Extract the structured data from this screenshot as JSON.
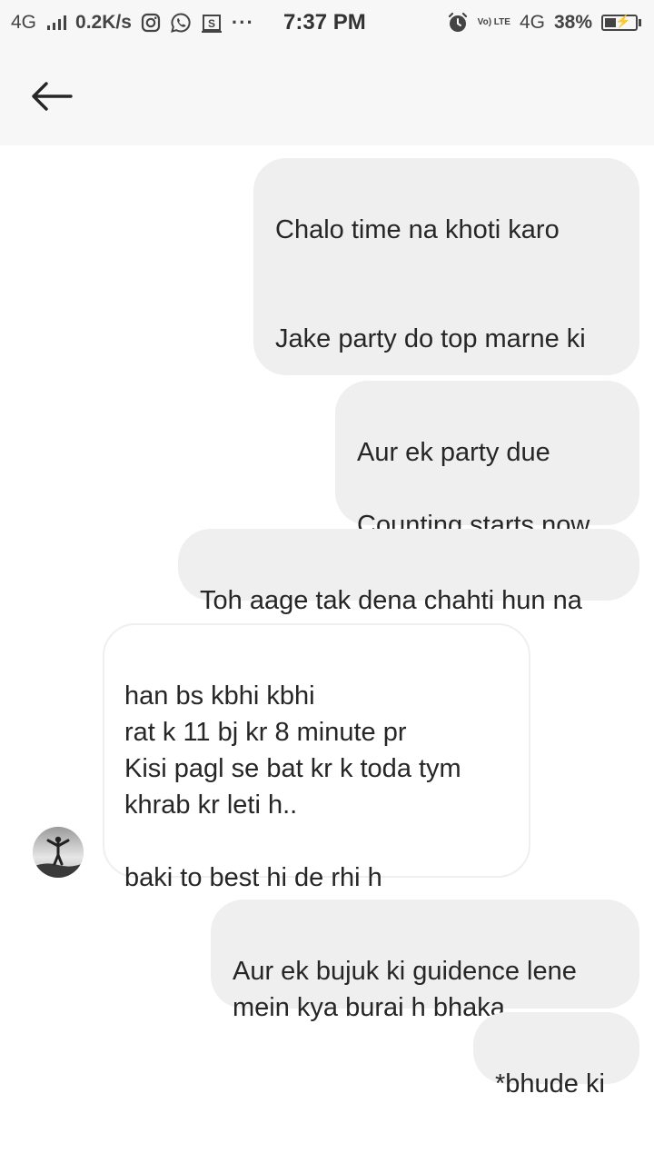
{
  "status_bar": {
    "network_left": "4G",
    "speed": "0.2K/s",
    "overflow": "···",
    "time": "7:37 PM",
    "volte": "Vo) LTE",
    "network_right": "4G",
    "battery": "38%"
  },
  "header": {
    "back_icon": "arrow-left-icon"
  },
  "messages": [
    {
      "direction": "out",
      "text": "Chalo time na khoti karo\n\n\nJake party do top marne ki"
    },
    {
      "direction": "out",
      "text": "Aur ek party due\n\nCounting starts now"
    },
    {
      "direction": "out",
      "text": "Toh aage tak dena chahti hun na"
    },
    {
      "direction": "in",
      "text": "han bs kbhi kbhi\nrat k 11 bj kr 8 minute pr\nKisi pagl se bat kr k toda tym\nkhrab  kr leti h..\n\nbaki to best hi de rhi h"
    },
    {
      "direction": "out",
      "text": "Aur ek bujuk ki guidence lene\nmein kya burai h bhaka"
    },
    {
      "direction": "out",
      "text": "*bhude ki"
    }
  ],
  "colors": {
    "outgoing_bubble": "#efefef",
    "incoming_border": "#efefef",
    "header_bg": "#f7f7f7",
    "text": "#262626"
  }
}
